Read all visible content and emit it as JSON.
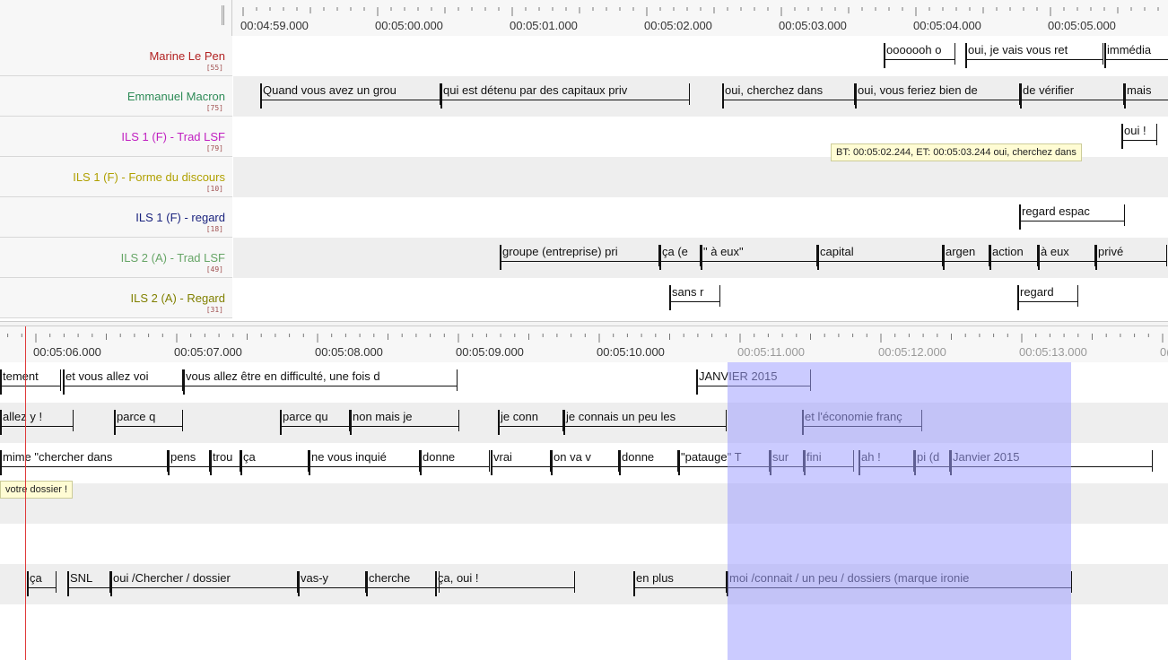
{
  "colors": {
    "selection": "#a0a0ff",
    "cursor": "#e03a3a",
    "tooltip_bg": "#fffcd4"
  },
  "tiers": [
    {
      "name": "Marine Le Pen",
      "count": "[55]",
      "color": "#b22222"
    },
    {
      "name": "Emmanuel Macron",
      "count": "[75]",
      "color": "#2e8b57"
    },
    {
      "name": "ILS 1 (F) - Trad LSF",
      "count": "[79]",
      "color": "#c020c0"
    },
    {
      "name": "ILS 1 (F) - Forme du discours",
      "count": "[10]",
      "color": "#b0a000"
    },
    {
      "name": "ILS 1 (F) - regard",
      "count": "[18]",
      "color": "#1a237e"
    },
    {
      "name": "ILS 2 (A) - Trad LSF",
      "count": "[49]",
      "color": "#66a566"
    },
    {
      "name": "ILS 2 (A) - Regard",
      "count": "[31]",
      "color": "#808000"
    }
  ],
  "top_ruler": {
    "ticks": [
      "00:04:59.000",
      "00:05:00.000",
      "00:05:01.000",
      "00:05:02.000",
      "00:05:03.000",
      "00:05:04.000",
      "00:05:05.000"
    ]
  },
  "bottom_ruler": {
    "ticks": [
      "00:05:06.000",
      "00:05:07.000",
      "00:05:08.000",
      "00:05:09.000",
      "00:05:10.000",
      "00:05:11.000",
      "00:05:12.000",
      "00:05:13.000",
      "0("
    ]
  },
  "top_annotations": [
    [
      "ooooooh o",
      "oui, je vais vous ret",
      "immédia"
    ],
    [
      "Quand vous avez un grou",
      "qui est détenu par des capitaux priv",
      "oui, cherchez dans",
      "oui, vous feriez bien de",
      "de vérifier",
      "mais"
    ],
    [
      "oui !"
    ],
    [],
    [
      "regard espac"
    ],
    [
      "groupe (entreprise) pri",
      "ça (e",
      "\" à eux\"",
      "capital",
      "argen",
      "action",
      "à eux",
      "privé"
    ],
    [
      "sans r",
      "regard"
    ]
  ],
  "tooltip_top": "BT: 00:05:02.244, ET: 00:05:03.244 oui, cherchez dans",
  "bottom_annotations": [
    [
      "tement",
      "et vous allez voi",
      "vous allez être en difficulté, une fois d",
      "JANVIER 2015"
    ],
    [
      "allez y !",
      "parce q",
      "parce qu",
      "non mais je",
      "je conn",
      "je connais un peu les",
      "et l'économie franç"
    ],
    [
      "mime \"chercher dans",
      "pens",
      "trou",
      "ça",
      "ne vous inquié",
      "donne",
      "vrai",
      "on va v",
      "donne",
      "\"patauge\" T",
      "sur",
      "fini",
      "ah !",
      "pi (d",
      "Janvier 2015"
    ],
    [],
    [],
    [
      "ça",
      "SNL",
      "oui /Chercher / dossier",
      "vas-y",
      "cherche",
      "ça, oui !",
      "en plus",
      "moi /connait  / un peu / dossiers (marque ironie"
    ],
    []
  ],
  "tooltip_bottom": "votre dossier !"
}
